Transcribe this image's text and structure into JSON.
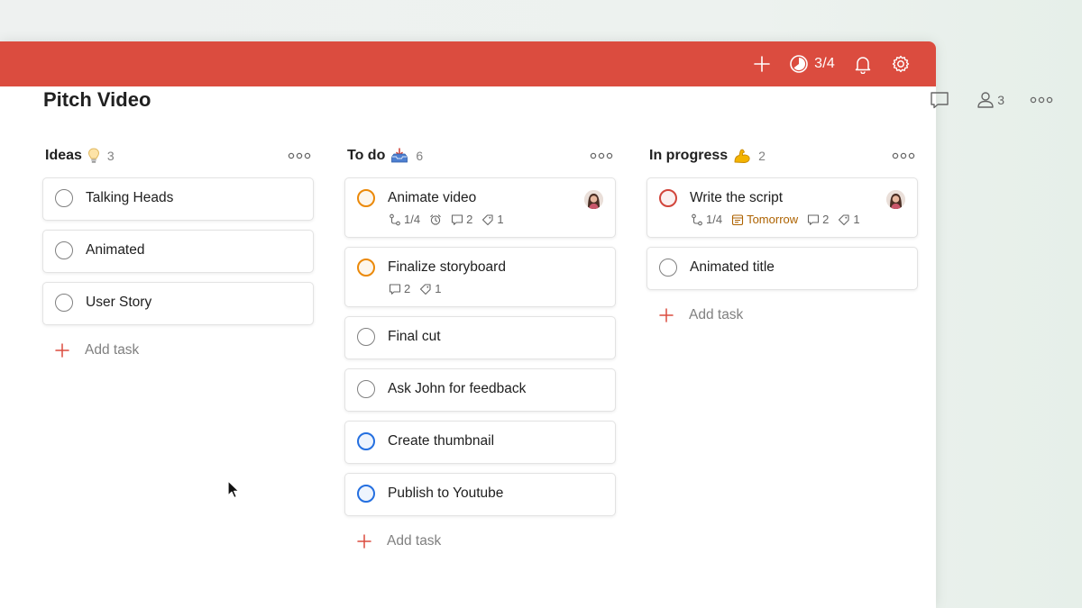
{
  "topbar": {
    "add_icon": "plus-icon",
    "karma_text": "3/4",
    "notifications_icon": "bell-icon",
    "settings_icon": "gear-icon",
    "color": "#db4c3f"
  },
  "project": {
    "title": "Pitch Video",
    "comments_icon": "comment-icon",
    "share_count": "3",
    "more_icon": "more-dots-icon"
  },
  "columns": [
    {
      "title": "Ideas",
      "emoji": "lightbulb",
      "count": "3",
      "tasks": [
        {
          "name": "Talking Heads"
        },
        {
          "name": "Animated"
        },
        {
          "name": "User Story"
        }
      ],
      "add_label": "Add task"
    },
    {
      "title": "To do",
      "emoji": "inbox-tray",
      "count": "6",
      "tasks": [
        {
          "name": "Animate video",
          "priority": "p2",
          "subtasks": "1/4",
          "comments": "2",
          "labels": "1",
          "reminder": true,
          "avatar": true
        },
        {
          "name": "Finalize storyboard",
          "priority": "p2",
          "comments": "2",
          "labels": "1"
        },
        {
          "name": "Final cut"
        },
        {
          "name": "Ask John for feedback"
        },
        {
          "name": "Create thumbnail",
          "priority": "p3"
        },
        {
          "name": "Publish to Youtube",
          "priority": "p3"
        }
      ],
      "add_label": "Add task"
    },
    {
      "title": "In progress",
      "emoji": "flexed-biceps",
      "count": "2",
      "tasks": [
        {
          "name": "Write the script",
          "priority": "p1",
          "subtasks": "1/4",
          "due": "Tomorrow",
          "comments": "2",
          "labels": "1",
          "avatar": true
        },
        {
          "name": "Animated title"
        }
      ],
      "add_label": "Add task"
    }
  ],
  "colors": {
    "accent": "#db4c3f",
    "priority_1": "#d1453b",
    "priority_2": "#eb8909",
    "priority_3": "#246fe0",
    "due_tomorrow": "#ad6200"
  }
}
